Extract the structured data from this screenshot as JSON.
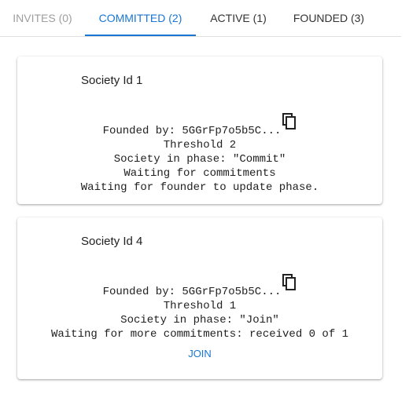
{
  "tabs": [
    {
      "label": "INVITES (0)",
      "state": "disabled"
    },
    {
      "label": "COMMITTED (2)",
      "state": "selected"
    },
    {
      "label": "ACTIVE (1)",
      "state": "normal"
    },
    {
      "label": "FOUNDED (3)",
      "state": "normal"
    }
  ],
  "colors": {
    "accent": "#1976d2",
    "disabled": "#9e9e9e",
    "text": "#212121"
  },
  "societies": [
    {
      "title": "Society Id 1",
      "founded_by": "Founded by: 5GGrFp7o5b5C...",
      "copy_icon": "copy-icon",
      "threshold": "Threshold 2",
      "phase": "Society in phase: \"Commit\"",
      "status1": "Waiting for commitments",
      "status2": "Waiting for founder to update phase."
    },
    {
      "title": "Society Id 4",
      "founded_by": "Founded by: 5GGrFp7o5b5C...",
      "copy_icon": "copy-icon",
      "threshold": "Threshold 1",
      "phase": "Society in phase: \"Join\"",
      "status1": "Waiting for more commitments: received 0 of 1",
      "join_label": "JOIN"
    }
  ]
}
